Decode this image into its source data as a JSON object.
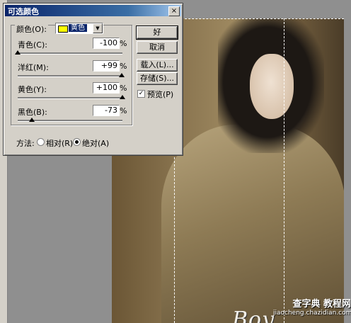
{
  "dialog": {
    "title": "可选颜色",
    "close_symbol": "×",
    "color_label": "颜色(O):",
    "color_value": "黄色",
    "color_swatch": "#ffff00",
    "rows": [
      {
        "label": "青色(C):",
        "value": "-100",
        "unit": "%",
        "slider_fraction": 0.0
      },
      {
        "label": "洋红(M):",
        "value": "+99",
        "unit": "%",
        "slider_fraction": 0.995
      },
      {
        "label": "黄色(Y):",
        "value": "+100",
        "unit": "%",
        "slider_fraction": 1.0
      },
      {
        "label": "黑色(B):",
        "value": "-73",
        "unit": "%",
        "slider_fraction": 0.135
      }
    ],
    "method_label": "方法:",
    "method_options": [
      {
        "label": "相对(R)",
        "selected": false
      },
      {
        "label": "绝对(A)",
        "selected": true
      }
    ],
    "buttons": {
      "ok": "好",
      "cancel": "取消",
      "load": "载入(L)...",
      "save": "存储(S)..."
    },
    "preview_label": "预览(P)",
    "preview_checked": true,
    "check_symbol": "✓"
  },
  "photo": {
    "logo_text": "Boy"
  },
  "watermark": {
    "line1": "查字典 教程网",
    "line2": "jiaocheng.chazidian.com"
  },
  "icons": {
    "dropdown": "chevron-down-icon",
    "close": "close-icon"
  }
}
